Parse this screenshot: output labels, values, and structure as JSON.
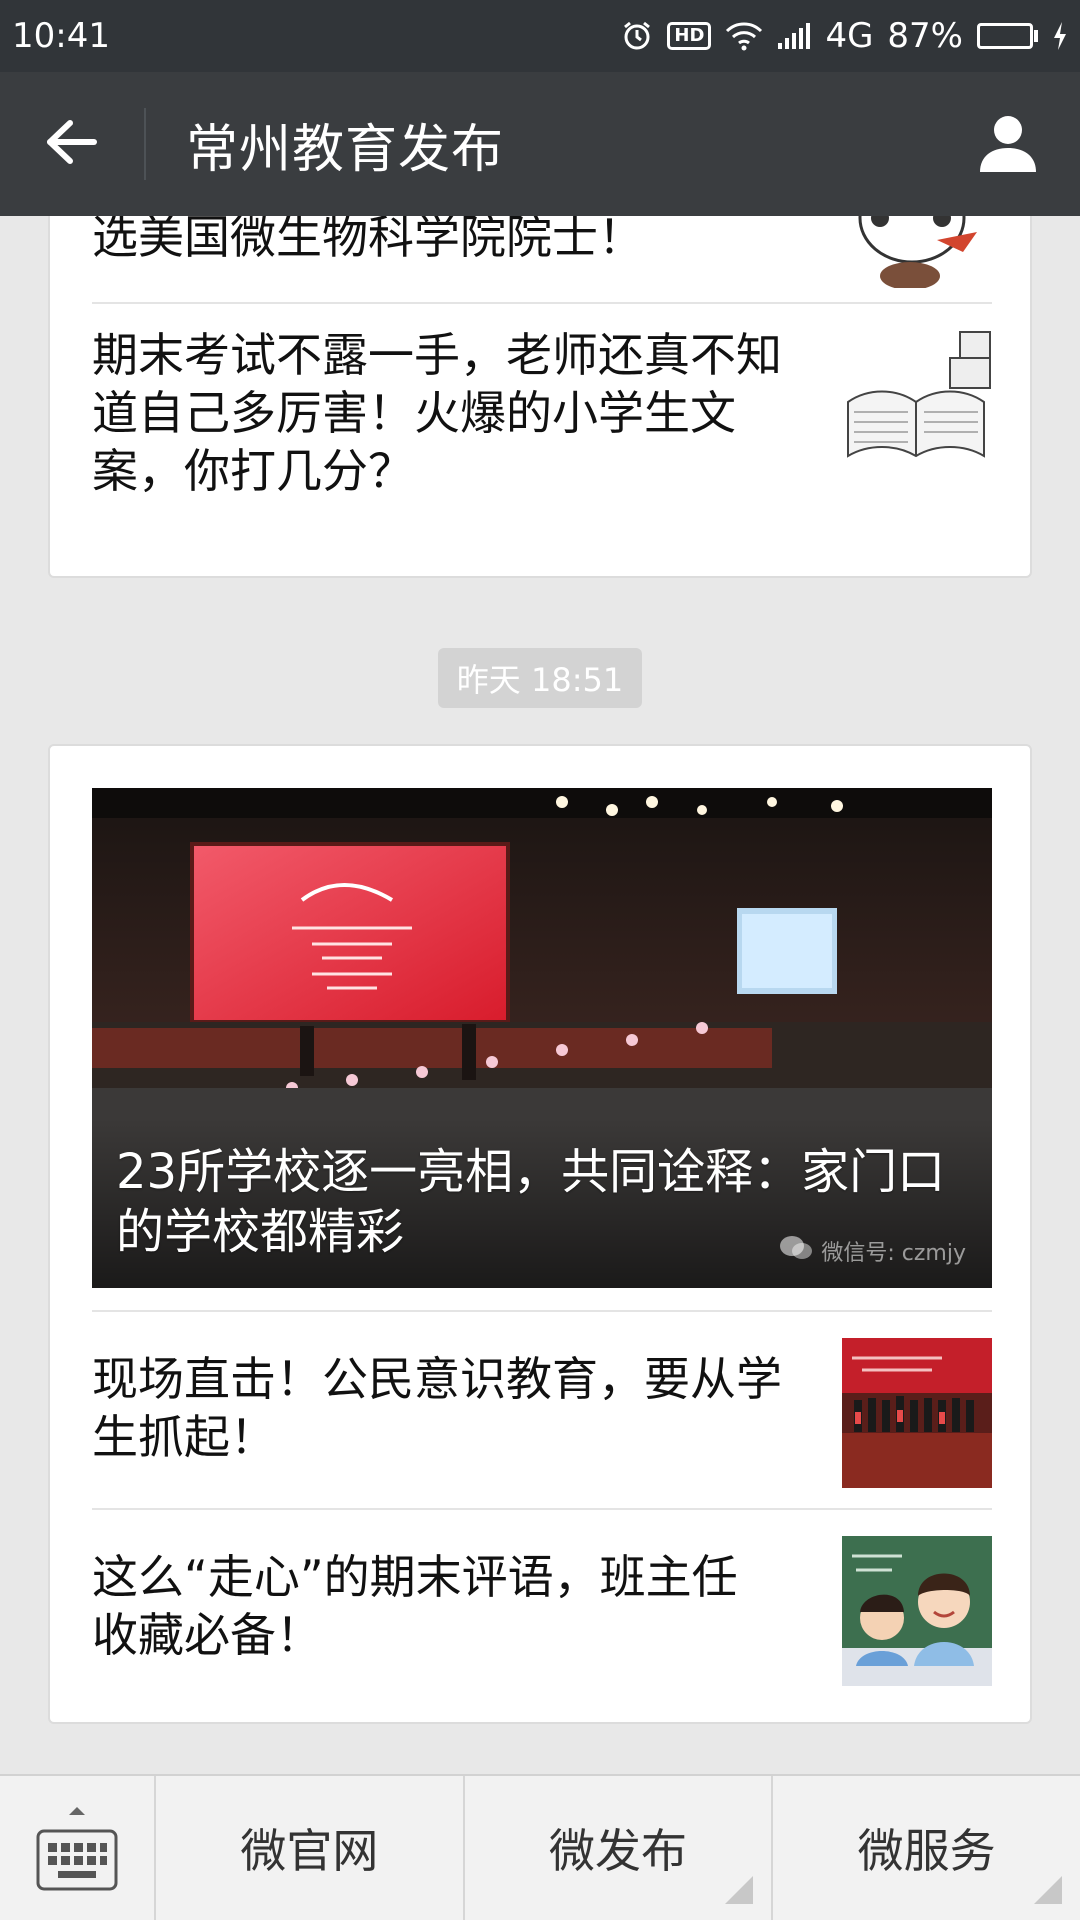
{
  "status_bar": {
    "time": "10:41",
    "hd_label": "HD",
    "network": "4G",
    "battery_percent": "87%",
    "battery_level": 0.87,
    "icons": [
      "alarm-icon",
      "hd-icon",
      "wifi-icon",
      "signal-icon",
      "battery-icon",
      "charging-icon"
    ]
  },
  "header": {
    "title": "常州教育发布",
    "back_icon": "arrow-left-icon",
    "profile_icon": "person-icon"
  },
  "feed": {
    "card1": {
      "items": [
        {
          "title": "选美国微生物科学院院士！"
        },
        {
          "title": "期末考试不露一手，老师还真不知道自己多厉害！火爆的小学生文案，你打几分？"
        }
      ]
    },
    "timestamp": "昨天 18:51",
    "card2": {
      "cover_title": "23所学校逐一亮相，共同诠释：家门口的学校都精彩",
      "watermark": "微信号: czmjy",
      "items": [
        {
          "title": "现场直击！公民意识教育，要从学生抓起！"
        },
        {
          "title": "这么“走心”的期末评语，班主任收藏必备！"
        }
      ]
    }
  },
  "bottom_menu": {
    "keyboard_icon": "keyboard-icon",
    "items": [
      {
        "label": "微官网"
      },
      {
        "label": "微发布"
      },
      {
        "label": "微服务"
      }
    ]
  },
  "colors": {
    "status_bg": "#313539",
    "header_bg": "#3a3d40",
    "page_bg": "#e8e8e8",
    "battery_green": "#3bd64c"
  }
}
